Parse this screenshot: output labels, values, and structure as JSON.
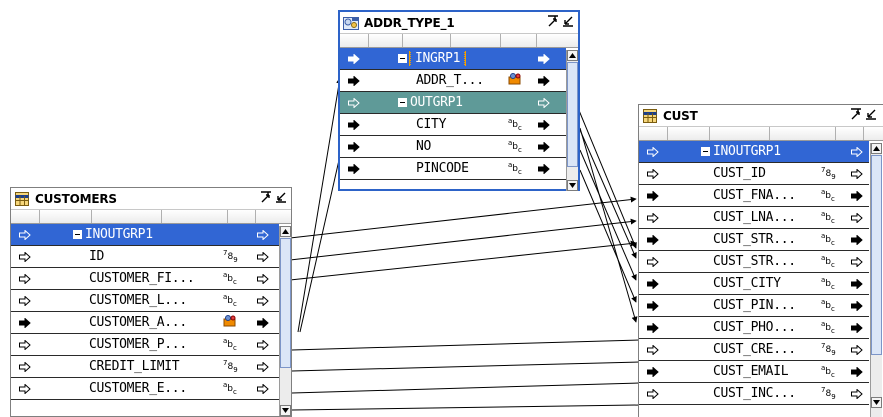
{
  "colors": {
    "accent": "#3166d4",
    "group_out": "#5f9a98",
    "selected_border": "#2d63c8",
    "focus": "#f2a000",
    "icon_orange": "#f08a00"
  },
  "addr_type": {
    "title": "ADDR_TYPE_1",
    "icon": "transformation-icon",
    "rows": [
      {
        "name": "INGRP1",
        "kind": "group-in",
        "port": "in"
      },
      {
        "name": "ADDR_T...",
        "kind": "field",
        "port": "in",
        "datatype": "object-icon"
      },
      {
        "name": "OUTGRP1",
        "kind": "group-out",
        "port": "out"
      },
      {
        "name": "CITY",
        "kind": "field",
        "port": "out",
        "datatype": "abc"
      },
      {
        "name": "NO",
        "kind": "field",
        "port": "out",
        "datatype": "abc"
      },
      {
        "name": "PINCODE",
        "kind": "field",
        "port": "out",
        "datatype": "abc"
      }
    ]
  },
  "customers": {
    "title": "CUSTOMERS",
    "icon": "table-icon",
    "rows": [
      {
        "name": "INOUTGRP1",
        "kind": "group-in",
        "port": "inout"
      },
      {
        "name": "ID",
        "kind": "field",
        "port": "inout",
        "datatype": "789"
      },
      {
        "name": "CUSTOMER_FI...",
        "kind": "field",
        "port": "inout",
        "datatype": "abc"
      },
      {
        "name": "CUSTOMER_L...",
        "kind": "field",
        "port": "inout",
        "datatype": "abc"
      },
      {
        "name": "CUSTOMER_A...",
        "kind": "field",
        "port": "in",
        "datatype": "object-icon"
      },
      {
        "name": "CUSTOMER_P...",
        "kind": "field",
        "port": "inout",
        "datatype": "abc"
      },
      {
        "name": "CREDIT_LIMIT",
        "kind": "field",
        "port": "inout",
        "datatype": "789"
      },
      {
        "name": "CUSTOMER_E...",
        "kind": "field",
        "port": "inout",
        "datatype": "abc"
      }
    ]
  },
  "cust": {
    "title": "CUST",
    "icon": "table-icon",
    "rows": [
      {
        "name": "INOUTGRP1",
        "kind": "group-in",
        "port": "inout"
      },
      {
        "name": "CUST_ID",
        "kind": "field",
        "port": "inout",
        "datatype": "789"
      },
      {
        "name": "CUST_FNA...",
        "kind": "field",
        "port": "in",
        "datatype": "abc"
      },
      {
        "name": "CUST_LNA...",
        "kind": "field",
        "port": "inout",
        "datatype": "abc"
      },
      {
        "name": "CUST_STR...",
        "kind": "field",
        "port": "in",
        "datatype": "abc"
      },
      {
        "name": "CUST_STR...",
        "kind": "field",
        "port": "inout",
        "datatype": "abc"
      },
      {
        "name": "CUST_CITY",
        "kind": "field",
        "port": "in",
        "datatype": "abc"
      },
      {
        "name": "CUST_PIN...",
        "kind": "field",
        "port": "in",
        "datatype": "abc"
      },
      {
        "name": "CUST_PHO...",
        "kind": "field",
        "port": "in",
        "datatype": "abc"
      },
      {
        "name": "CUST_CRE...",
        "kind": "field",
        "port": "inout",
        "datatype": "789"
      },
      {
        "name": "CUST_EMAIL",
        "kind": "field",
        "port": "in",
        "datatype": "abc"
      },
      {
        "name": "CUST_INC...",
        "kind": "field",
        "port": "inout",
        "datatype": "789"
      }
    ]
  }
}
